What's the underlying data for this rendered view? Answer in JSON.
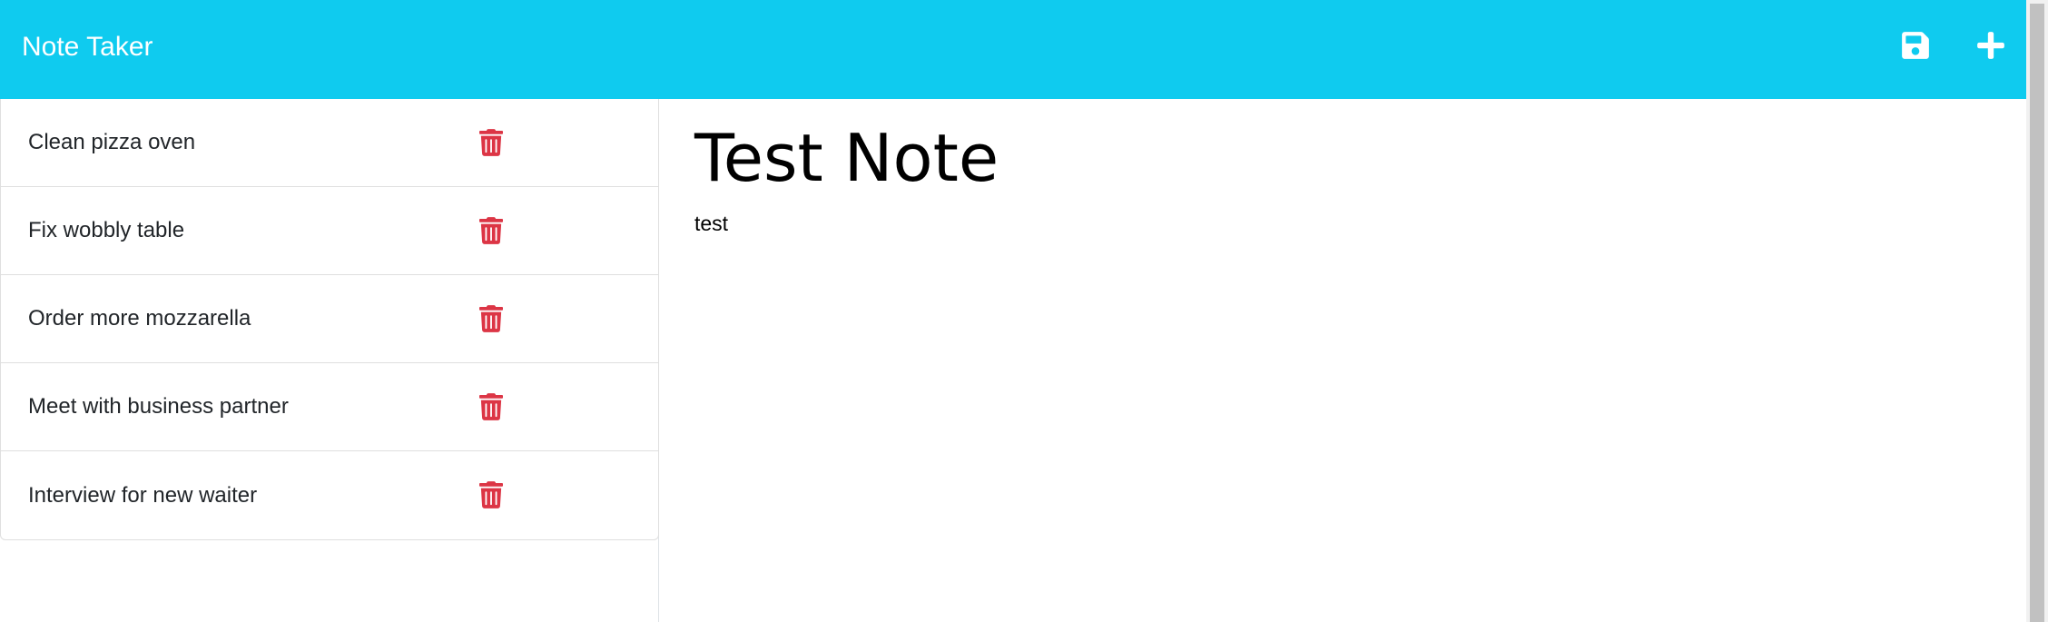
{
  "app": {
    "brand": "Note Taker",
    "accent_color": "#0fcbef",
    "delete_color": "#dc3545"
  },
  "navbar": {
    "save_icon": "save-icon",
    "new_icon": "plus-icon"
  },
  "notes": [
    {
      "title": "Clean pizza oven"
    },
    {
      "title": "Fix wobbly table"
    },
    {
      "title": "Order more mozzarella"
    },
    {
      "title": "Meet with business partner"
    },
    {
      "title": "Interview for new waiter"
    }
  ],
  "active_note": {
    "title": "Test Note",
    "text": "test"
  }
}
